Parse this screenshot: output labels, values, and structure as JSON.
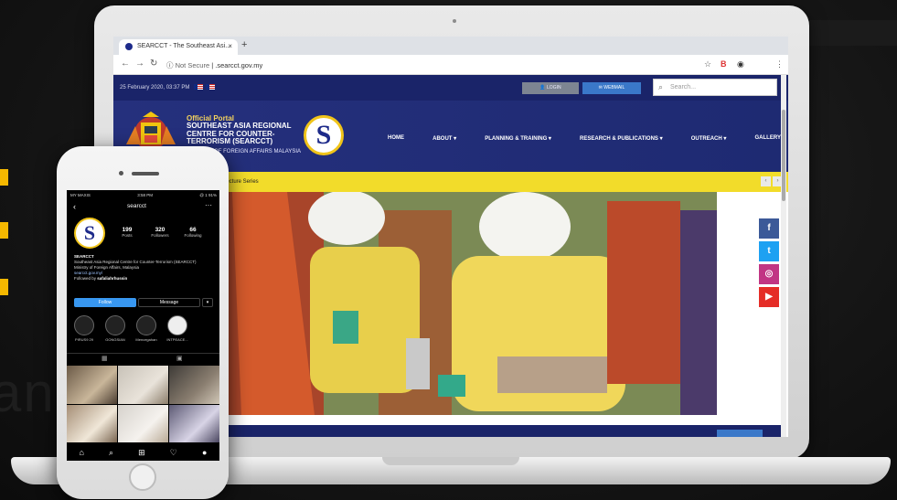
{
  "browser": {
    "tab_title": "SEARCCT - The Southeast Asi...",
    "tab_close": "×",
    "new_tab": "+",
    "security": "Not Secure",
    "url": ".searcct.gov.my"
  },
  "site": {
    "datetime": "25 February 2020, 03:37 PM",
    "login_label": "LOGIN",
    "webmail_label": "WEBMAIL",
    "search_placeholder": "Search...",
    "portal_line1": "Official Portal",
    "portal_line2": "SOUTHEAST ASIA REGIONAL CENTRE FOR COUNTER-TERRORISM (SEARCCT)",
    "portal_line3": "MINISTRY OF FOREIGN AFFAIRS MALAYSIA",
    "logo_letter": "S",
    "nav": [
      "HOME",
      "ABOUT ▾",
      "PLANNING & TRAINING ▾",
      "RESEARCH & PUBLICATIONS ▾",
      "OUTREACH ▾",
      "GALLERY"
    ],
    "ticker": "Lecture Series",
    "social": [
      {
        "name": "facebook-icon",
        "glyph": "f",
        "color": "#3b5998"
      },
      {
        "name": "twitter-icon",
        "glyph": "t",
        "color": "#1da1f2"
      },
      {
        "name": "instagram-icon",
        "glyph": "◎",
        "color": "#c13584"
      },
      {
        "name": "youtube-icon",
        "glyph": "▶",
        "color": "#e52d27"
      }
    ]
  },
  "phone": {
    "carrier": "MY MAXIS",
    "time": "3:58 PM",
    "battery": "@ 1 91%",
    "handle": "searcct",
    "avatar_letter": "S",
    "stats": [
      {
        "value": "199",
        "label": "Posts"
      },
      {
        "value": "320",
        "label": "Followers"
      },
      {
        "value": "66",
        "label": "Following"
      }
    ],
    "bio_name": "SEARCCT",
    "bio_line1": "Southeast Asia Regional Centre for Counter-Terrorism (SEARCCT)",
    "bio_line2": "Ministry of Foreign Affairs, Malaysia",
    "bio_link": "searcct.gov.my/",
    "bio_followed": "Followed by ",
    "bio_followed_name": "safaliahrhussin",
    "follow_label": "Follow",
    "message_label": "Message",
    "dropdown_label": "▾",
    "highlights": [
      "PIRUS9 29",
      "GONGSIAN",
      "Mencegahan",
      "INTPEACE..."
    ]
  }
}
